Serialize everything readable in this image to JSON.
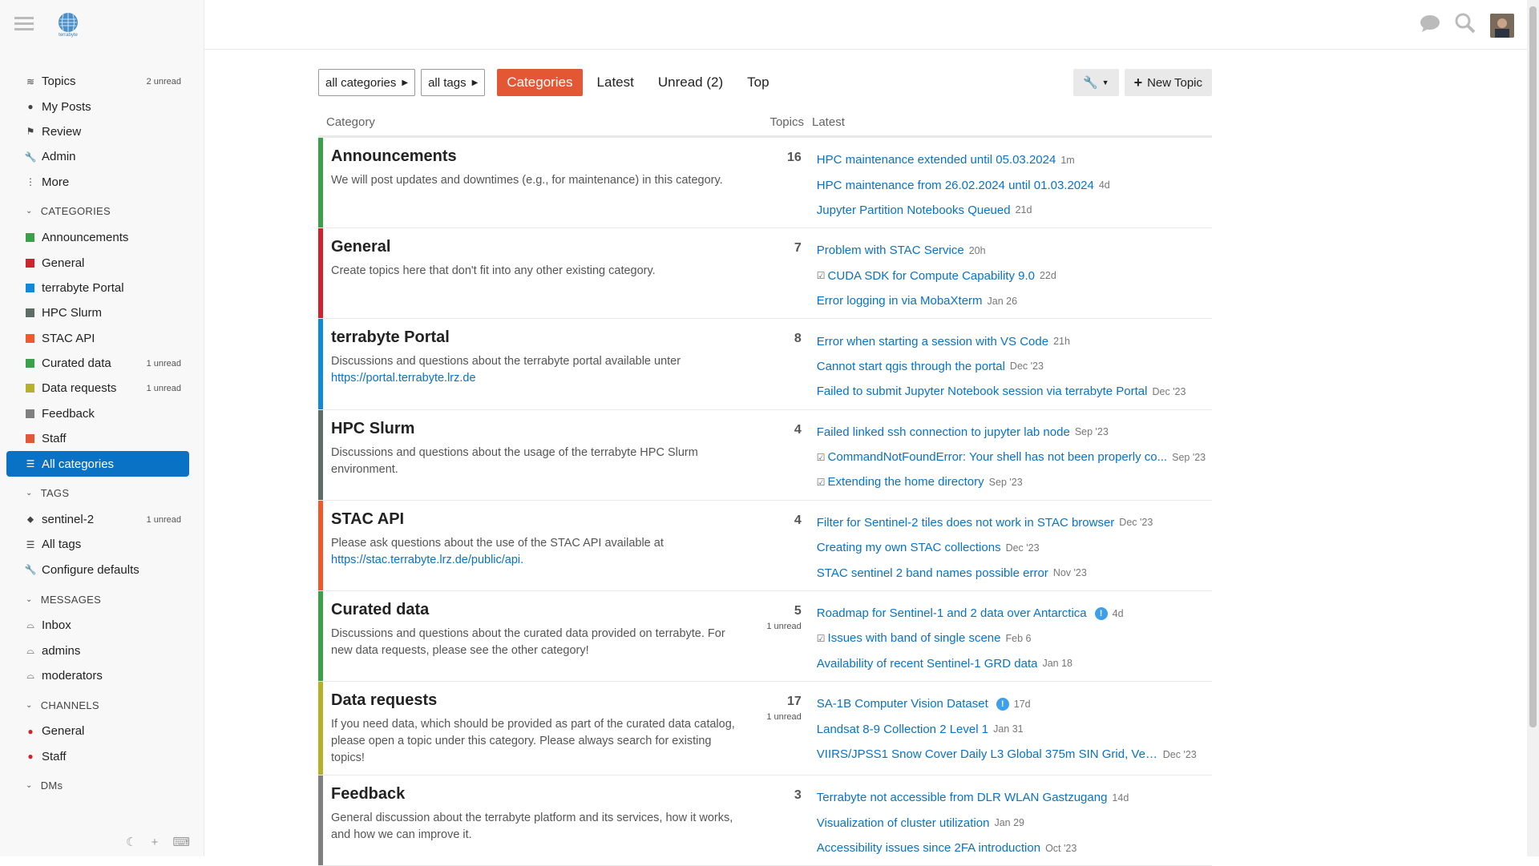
{
  "sidebar": {
    "logo_text": "terrabyte",
    "nav": [
      {
        "label": "Topics",
        "badge": "2 unread",
        "icon": "layers-icon"
      },
      {
        "label": "My Posts",
        "badge": "",
        "icon": "user-icon"
      },
      {
        "label": "Review",
        "badge": "",
        "icon": "flag-icon"
      },
      {
        "label": "Admin",
        "badge": "",
        "icon": "wrench-icon"
      },
      {
        "label": "More",
        "badge": "",
        "icon": "more-vertical-icon"
      }
    ],
    "categories_heading": "CATEGORIES",
    "categories": [
      {
        "label": "Announcements",
        "color": "#3aa04a",
        "badge": ""
      },
      {
        "label": "General",
        "color": "#d0232e",
        "badge": ""
      },
      {
        "label": "terrabyte Portal",
        "color": "#1188d8",
        "badge": ""
      },
      {
        "label": "HPC Slurm",
        "color": "#5e6d66",
        "badge": ""
      },
      {
        "label": "STAC API",
        "color": "#f0592a",
        "badge": ""
      },
      {
        "label": "Curated data",
        "color": "#3aa04a",
        "badge": "1 unread"
      },
      {
        "label": "Data requests",
        "color": "#b5b22a",
        "badge": "1 unread"
      },
      {
        "label": "Feedback",
        "color": "#808080",
        "badge": ""
      },
      {
        "label": "Staff",
        "color": "#e45735",
        "badge": ""
      }
    ],
    "all_categories": "All categories",
    "tags_heading": "TAGS",
    "tags": [
      {
        "label": "sentinel-2",
        "badge": "1 unread",
        "icon": "tag-icon"
      },
      {
        "label": "All tags",
        "badge": "",
        "icon": "list-icon"
      },
      {
        "label": "Configure defaults",
        "badge": "",
        "icon": "wrench-icon"
      }
    ],
    "messages_heading": "MESSAGES",
    "messages": [
      {
        "label": "Inbox"
      },
      {
        "label": "admins"
      },
      {
        "label": "moderators"
      }
    ],
    "channels_heading": "CHANNELS",
    "channels": [
      {
        "label": "General"
      },
      {
        "label": "Staff"
      }
    ],
    "dms_heading": "DMs"
  },
  "nav": {
    "all_categories": "all categories",
    "all_tags": "all tags",
    "tabs": [
      "Categories",
      "Latest",
      "Unread (2)",
      "Top"
    ],
    "new_topic": "New Topic"
  },
  "table": {
    "col_category": "Category",
    "col_topics": "Topics",
    "col_latest": "Latest",
    "rows": [
      {
        "name": "Announcements",
        "color": "#3aa04a",
        "desc": "We will post updates and downtimes (e.g., for maintenance) in this category.",
        "link": "",
        "count": "16",
        "unread": "",
        "topics": [
          {
            "title": "HPC maintenance extended until 05.03.2024",
            "age": "1m",
            "check": false,
            "dot": false
          },
          {
            "title": "HPC maintenance from 26.02.2024 until 01.03.2024",
            "age": "4d",
            "check": false,
            "dot": false
          },
          {
            "title": "Jupyter Partition Notebooks Queued",
            "age": "21d",
            "check": false,
            "dot": false
          }
        ]
      },
      {
        "name": "General",
        "color": "#d0232e",
        "desc": "Create topics here that don't fit into any other existing category.",
        "link": "",
        "count": "7",
        "unread": "",
        "topics": [
          {
            "title": "Problem with STAC Service",
            "age": "20h",
            "check": false,
            "dot": false
          },
          {
            "title": "CUDA SDK for Compute Capability 9.0",
            "age": "22d",
            "check": true,
            "dot": false
          },
          {
            "title": "Error logging in via MobaXterm",
            "age": "Jan 26",
            "check": false,
            "dot": false
          }
        ]
      },
      {
        "name": "terrabyte Portal",
        "color": "#1188d8",
        "desc": "Discussions and questions about the terrabyte portal available unter ",
        "link": "https://portal.terrabyte.lrz.de",
        "count": "8",
        "unread": "",
        "topics": [
          {
            "title": "Error when starting a session with VS Code",
            "age": "21h",
            "check": false,
            "dot": false
          },
          {
            "title": "Cannot start qgis through the portal",
            "age": "Dec '23",
            "check": false,
            "dot": false
          },
          {
            "title": "Failed to submit Jupyter Notebook session via terrabyte Portal",
            "age": "Dec '23",
            "check": false,
            "dot": false
          }
        ]
      },
      {
        "name": "HPC Slurm",
        "color": "#5e6d66",
        "desc": "Discussions and questions about the usage of the terrabyte HPC Slurm environment.",
        "link": "",
        "count": "4",
        "unread": "",
        "topics": [
          {
            "title": "Failed linked ssh connection to jupyter lab node",
            "age": "Sep '23",
            "check": false,
            "dot": false
          },
          {
            "title": "CommandNotFoundError: Your shell has not been properly co...",
            "age": "Sep '23",
            "check": true,
            "dot": false
          },
          {
            "title": "Extending the home directory",
            "age": "Sep '23",
            "check": true,
            "dot": false
          }
        ]
      },
      {
        "name": "STAC API",
        "color": "#f0592a",
        "desc": "Please ask questions about the use of the STAC API available at ",
        "link": "https://stac.terrabyte.lrz.de/public/api.",
        "count": "4",
        "unread": "",
        "topics": [
          {
            "title": "Filter for Sentinel-2 tiles does not work in STAC browser",
            "age": "Dec '23",
            "check": false,
            "dot": false
          },
          {
            "title": "Creating my own STAC collections",
            "age": "Dec '23",
            "check": false,
            "dot": false
          },
          {
            "title": "STAC sentinel 2 band names possible error",
            "age": "Nov '23",
            "check": false,
            "dot": false
          }
        ]
      },
      {
        "name": "Curated data",
        "color": "#3aa04a",
        "desc": "Discussions and questions about the curated data provided on terrabyte. For new data requests, please see the other category!",
        "link": "",
        "count": "5",
        "unread": "1 unread",
        "topics": [
          {
            "title": "Roadmap for Sentinel-1 and 2 data over Antarctica",
            "age": "4d",
            "check": false,
            "dot": true
          },
          {
            "title": "Issues with band of single scene",
            "age": "Feb 6",
            "check": true,
            "dot": false
          },
          {
            "title": "Availability of recent Sentinel-1 GRD data",
            "age": "Jan 18",
            "check": false,
            "dot": false
          }
        ]
      },
      {
        "name": "Data requests",
        "color": "#b5b22a",
        "desc": "If you need data, which should be provided as part of the curated data catalog, please open a topic under this category. Please always search for existing topics!",
        "link": "",
        "count": "17",
        "unread": "1 unread",
        "topics": [
          {
            "title": "SA-1B Computer Vision Dataset",
            "age": "17d",
            "check": false,
            "dot": true
          },
          {
            "title": "Landsat 8-9 Collection 2 Level 1",
            "age": "Jan 31",
            "check": false,
            "dot": false
          },
          {
            "title": "VIIRS/JPSS1 Snow Cover Daily L3 Global 375m SIN Grid, Versi...",
            "age": "Dec '23",
            "check": false,
            "dot": false
          }
        ]
      },
      {
        "name": "Feedback",
        "color": "#808080",
        "desc": "General discussion about the terrabyte platform and its services, how it works, and how we can improve it.",
        "link": "",
        "count": "3",
        "unread": "",
        "topics": [
          {
            "title": "Terrabyte not accessible from DLR WLAN Gastzugang",
            "age": "14d",
            "check": false,
            "dot": false
          },
          {
            "title": "Visualization of cluster utilization",
            "age": "Jan 29",
            "check": false,
            "dot": false
          },
          {
            "title": "Accessibility issues since 2FA introduction",
            "age": "Oct '23",
            "check": false,
            "dot": false
          }
        ]
      }
    ]
  }
}
